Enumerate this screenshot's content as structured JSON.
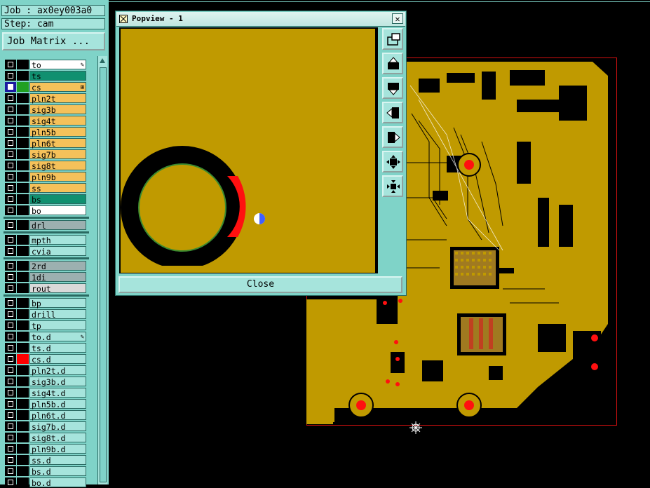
{
  "header": {
    "job": "Job : ax0ey003a0",
    "step": "Step: cam",
    "job_matrix_label": "Job Matrix ..."
  },
  "colors": {
    "panel_bg": "#7fd3c8",
    "signal_layer": "#f5c15a",
    "solder_mask": "#109070",
    "board_bg": "#c09a00",
    "drill": "#ff0000"
  },
  "layers": [
    {
      "name": "to",
      "color": "#ffffff",
      "swatch": "#000000",
      "mark": "pen",
      "selected": false
    },
    {
      "name": "ts",
      "color": "#109070",
      "swatch": "#000000",
      "mark": "",
      "selected": false
    },
    {
      "name": "cs",
      "color": "#f5c15a",
      "swatch": "#21a021",
      "mark": "grid",
      "selected": true
    },
    {
      "name": "pln2t",
      "color": "#f5c15a",
      "swatch": "#000000",
      "mark": "",
      "selected": false
    },
    {
      "name": "sig3b",
      "color": "#f5c15a",
      "swatch": "#000000",
      "mark": "",
      "selected": false
    },
    {
      "name": "sig4t",
      "color": "#f5c15a",
      "swatch": "#000000",
      "mark": "",
      "selected": false
    },
    {
      "name": "pln5b",
      "color": "#f5c15a",
      "swatch": "#000000",
      "mark": "",
      "selected": false
    },
    {
      "name": "pln6t",
      "color": "#f5c15a",
      "swatch": "#000000",
      "mark": "",
      "selected": false
    },
    {
      "name": "sig7b",
      "color": "#f5c15a",
      "swatch": "#000000",
      "mark": "",
      "selected": false
    },
    {
      "name": "sig8t",
      "color": "#f5c15a",
      "swatch": "#000000",
      "mark": "",
      "selected": false
    },
    {
      "name": "pln9b",
      "color": "#f5c15a",
      "swatch": "#000000",
      "mark": "",
      "selected": false
    },
    {
      "name": "ss",
      "color": "#f5c15a",
      "swatch": "#000000",
      "mark": "",
      "selected": false
    },
    {
      "name": "bs",
      "color": "#109070",
      "swatch": "#000000",
      "mark": "",
      "selected": false
    },
    {
      "name": "bo",
      "color": "#ffffff",
      "swatch": "#000000",
      "mark": "",
      "selected": false
    },
    {
      "name": "drl",
      "color": "#9cb0b0",
      "swatch": "#000000",
      "mark": "",
      "selected": false,
      "gap": true
    },
    {
      "name": "mpth",
      "color": "#a6e4dc",
      "swatch": "#000000",
      "mark": "",
      "selected": false,
      "gap": true
    },
    {
      "name": "cvia",
      "color": "#a6e4dc",
      "swatch": "#000000",
      "mark": "",
      "selected": false
    },
    {
      "name": "2rd",
      "color": "#9cb0b0",
      "swatch": "#000000",
      "mark": "",
      "selected": false,
      "gap": true
    },
    {
      "name": "1di",
      "color": "#9cb0b0",
      "swatch": "#000000",
      "mark": "",
      "selected": false
    },
    {
      "name": "rout",
      "color": "#d9d9d9",
      "swatch": "#000000",
      "mark": "",
      "selected": false
    },
    {
      "name": "bp",
      "color": "#a6e4dc",
      "swatch": "#000000",
      "mark": "",
      "selected": false,
      "gap": true
    },
    {
      "name": "drill",
      "color": "#a6e4dc",
      "swatch": "#000000",
      "mark": "",
      "selected": false
    },
    {
      "name": "tp",
      "color": "#a6e4dc",
      "swatch": "#000000",
      "mark": "",
      "selected": false
    },
    {
      "name": "to.d",
      "color": "#a6e4dc",
      "swatch": "#000000",
      "mark": "pen",
      "selected": false
    },
    {
      "name": "ts.d",
      "color": "#a6e4dc",
      "swatch": "#000000",
      "mark": "",
      "selected": false
    },
    {
      "name": "cs.d",
      "color": "#a6e4dc",
      "swatch": "#ff0000",
      "mark": "",
      "selected": false
    },
    {
      "name": "pln2t.d",
      "color": "#a6e4dc",
      "swatch": "#000000",
      "mark": "",
      "selected": false
    },
    {
      "name": "sig3b.d",
      "color": "#a6e4dc",
      "swatch": "#000000",
      "mark": "",
      "selected": false
    },
    {
      "name": "sig4t.d",
      "color": "#a6e4dc",
      "swatch": "#000000",
      "mark": "",
      "selected": false
    },
    {
      "name": "pln5b.d",
      "color": "#a6e4dc",
      "swatch": "#000000",
      "mark": "",
      "selected": false
    },
    {
      "name": "pln6t.d",
      "color": "#a6e4dc",
      "swatch": "#000000",
      "mark": "",
      "selected": false
    },
    {
      "name": "sig7b.d",
      "color": "#a6e4dc",
      "swatch": "#000000",
      "mark": "",
      "selected": false
    },
    {
      "name": "sig8t.d",
      "color": "#a6e4dc",
      "swatch": "#000000",
      "mark": "",
      "selected": false
    },
    {
      "name": "pln9b.d",
      "color": "#a6e4dc",
      "swatch": "#000000",
      "mark": "",
      "selected": false
    },
    {
      "name": "ss.d",
      "color": "#a6e4dc",
      "swatch": "#000000",
      "mark": "",
      "selected": false
    },
    {
      "name": "bs.d",
      "color": "#a6e4dc",
      "swatch": "#000000",
      "mark": "",
      "selected": false
    },
    {
      "name": "bo.d",
      "color": "#a6e4dc",
      "swatch": "#000000",
      "mark": "",
      "selected": false
    }
  ],
  "popup": {
    "title": "Popview - 1",
    "close_label": "Close",
    "tools": [
      "zoom-window-icon",
      "pan-up-icon",
      "pan-down-icon",
      "pan-left-icon",
      "pan-right-icon",
      "zoom-out-icon",
      "zoom-in-icon"
    ]
  }
}
